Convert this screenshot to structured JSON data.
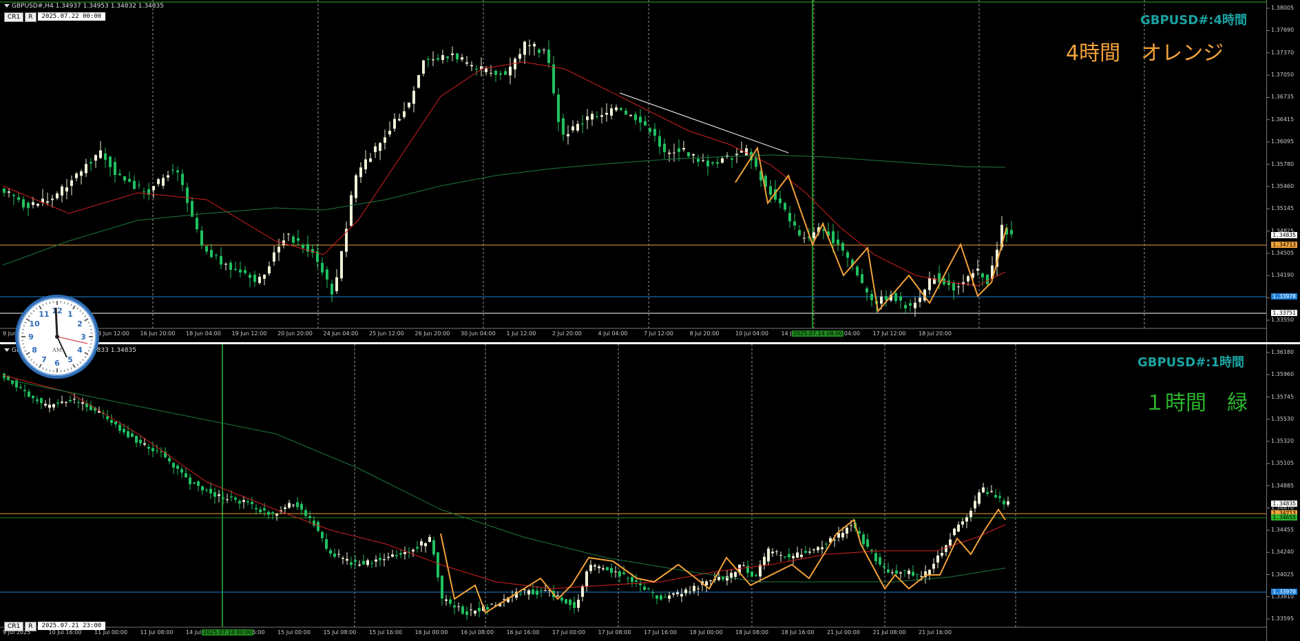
{
  "top_pane": {
    "ticker": "GBPUSD#,H4  1.34937 1.34953 1.34832 1.34835",
    "buttons": [
      "CR1",
      "R"
    ],
    "datetime": "2025.07.22 00:00",
    "symbol_label": "GBPUSD#:4時間",
    "note_label": "4時間　オレンジ",
    "note_color": "#f2a23a",
    "price_ticks": [
      "1.38005",
      "1.37690",
      "1.37370",
      "1.37050",
      "1.36735",
      "1.36415",
      "1.36095",
      "1.35780",
      "1.35460",
      "1.35145",
      "1.34825",
      "1.34505",
      "1.34190",
      "1.33870",
      "1.33550"
    ],
    "price_labels": [
      {
        "text": "1.34835",
        "bg": "#ffffff",
        "fg": "#000000"
      },
      {
        "text": "1.34713",
        "bg": "#f2a23a",
        "fg": "#000000"
      },
      {
        "text": "1.33970",
        "bg": "#1e7fd6",
        "fg": "#ffffff"
      },
      {
        "text": "1.33751",
        "bg": "#ffffff",
        "fg": "#000000"
      }
    ],
    "time_ticks": [
      "9 Jun",
      "12 Jun 04:00",
      "13 Jun 12:00",
      "16 Jun 20:00",
      "18 Jun 04:00",
      "19 Jun 12:00",
      "20 Jun 20:00",
      "24 Jun 04:00",
      "25 Jun 12:00",
      "26 Jun 20:00",
      "30 Jun 04:00",
      "1 Jul 12:00",
      "2 Jul 20:00",
      "4 Jul 04:00",
      "7 Jul 12:00",
      "8 Jul 20:00",
      "10 Jul 04:00",
      "14 Jul 20:00",
      "16 Jul 04:00",
      "17 Jul 12:00",
      "18 Jul 20:00"
    ],
    "highlight_time": "2025.07.14 08:00"
  },
  "bottom_pane": {
    "ticker": "GBPUSD#,H1  1.34917 1.34833 1.34835",
    "buttons": [
      "CR1",
      "R"
    ],
    "datetime": "2025.07.21 23:00",
    "symbol_label": "GBPUSD#:1時間",
    "note_label": "１時間　緑",
    "note_color": "#2db52d",
    "price_ticks": [
      "1.36180",
      "1.35960",
      "1.35745",
      "1.35530",
      "1.35320",
      "1.35105",
      "1.34885",
      "1.34670",
      "1.34455",
      "1.34240",
      "1.34025",
      "1.33810",
      "1.33595"
    ],
    "price_labels": [
      {
        "text": "1.34835",
        "bg": "#ffffff",
        "fg": "#000000"
      },
      {
        "text": "1.34713",
        "bg": "#f2a23a",
        "fg": "#000000"
      },
      {
        "text": "1.34655",
        "bg": "#2db52d",
        "fg": "#000000"
      },
      {
        "text": "1.33970",
        "bg": "#1e7fd6",
        "fg": "#ffffff"
      }
    ],
    "time_ticks": [
      "9 Jul 2025",
      "10 Jul 16:00",
      "11 Jul 00:00",
      "11 Jul 08:00",
      "14 Jul 08:00",
      "14 Jul 16:00",
      "15 Jul 00:00",
      "15 Jul 08:00",
      "15 Jul 16:00",
      "16 Jul 00:00",
      "16 Jul 08:00",
      "16 Jul 16:00",
      "17 Jul 00:00",
      "17 Jul 08:00",
      "17 Jul 16:00",
      "18 Jul 00:00",
      "18 Jul 08:00",
      "18 Jul 16:00",
      "21 Jul 00:00",
      "21 Jul 08:00",
      "21 Jul 16:00"
    ],
    "highlight_time": "2025.07.14 00:00"
  },
  "clock": {
    "numerals": [
      "12",
      "1",
      "2",
      "3",
      "4",
      "5",
      "6",
      "7",
      "8",
      "9",
      "10",
      "11"
    ],
    "ampm": "AM"
  },
  "colors": {
    "bull": "#f0f0d8",
    "bear": "#20c060",
    "ma_fast": "#d42020",
    "ma_slow": "#1f7a3e",
    "zigzag": "#f2a23a",
    "h_orange": "#f2a23a",
    "h_blue": "#1e7fd6",
    "v_green": "#1f8a1f"
  }
}
